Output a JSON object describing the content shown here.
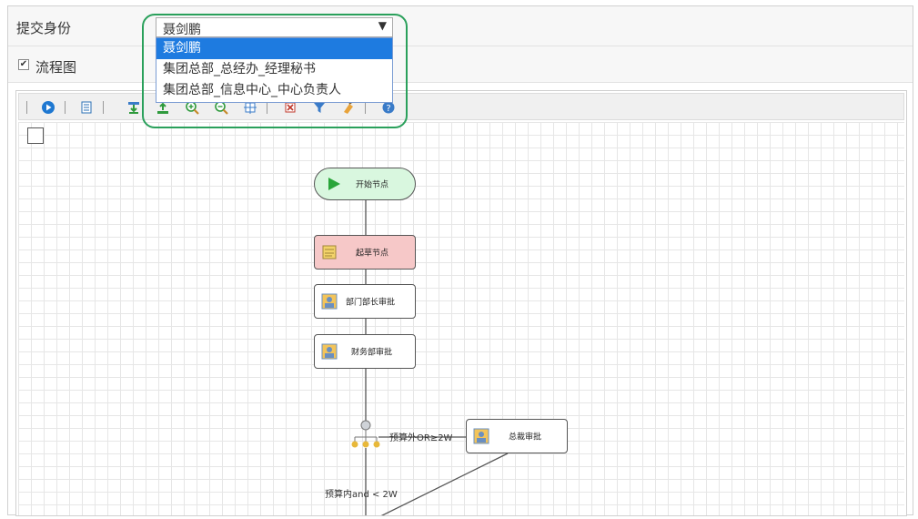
{
  "form": {
    "identity_label": "提交身份",
    "identity_selected": "聂剑鹏",
    "identity_options": [
      "聂剑鹏",
      "集团总部_总经办_经理秘书",
      "集团总部_信息中心_中心负责人"
    ],
    "flow_label": "流程图",
    "flow_checked": true
  },
  "toolbar": {
    "icons": [
      "play-icon",
      "page-icon",
      "import-icon",
      "export-icon",
      "zoom-in-icon",
      "zoom-out-icon",
      "fit-icon",
      "delete-icon",
      "filter-icon",
      "clear-icon",
      "help-icon"
    ]
  },
  "diagram": {
    "nodes": {
      "start": "开始节点",
      "draft": "起草节点",
      "dept_head": "部门部长审批",
      "finance": "财务部审批",
      "ceo": "总裁审批"
    },
    "edges": {
      "branch_out": "预算外OR≥2W",
      "branch_in": "预算内and < 2W"
    }
  },
  "colors": {
    "select_highlight": "#1e7be0",
    "ring": "#2aa05b",
    "start_fill": "#d9f7df",
    "draft_fill": "#f6c8c8"
  }
}
